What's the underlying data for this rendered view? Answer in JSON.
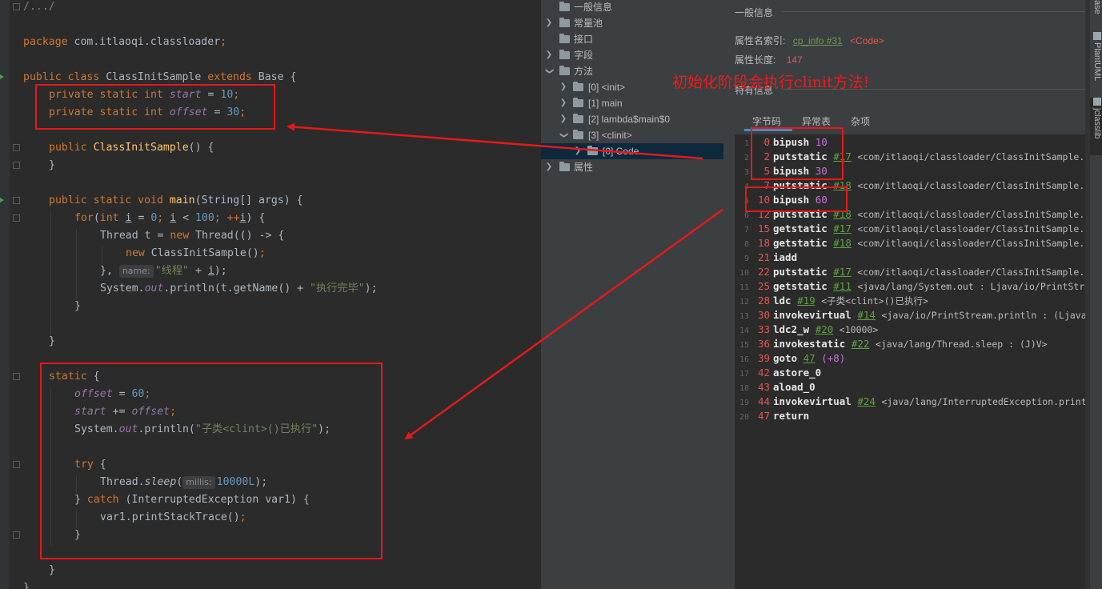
{
  "editor": {
    "lines": {
      "l1": {
        "comment": "/.../"
      },
      "l2": {
        "pkg": "package",
        "name": " com.itlaoqi.classloader",
        "semi": ";"
      },
      "l3": {
        "kw": "public class ",
        "cls": "ClassInitSample ",
        "ext": "extends ",
        "base": "Base {"
      },
      "l4": {
        "kw": "private static int ",
        "var": "start",
        "eq": " = ",
        "val": "10",
        "semi": ";"
      },
      "l5": {
        "kw": "private static int ",
        "var": "offset",
        "eq": " = ",
        "val": "30",
        "semi": ";"
      },
      "l6": {
        "kw": "public ",
        "mth": "ClassInitSample",
        "rest": "() {"
      },
      "l7": {
        "text": "}"
      },
      "l8": {
        "kw": "public static void ",
        "mth": "main",
        "rest": "(String[] args) {"
      },
      "l9": {
        "kw": "for",
        "a": "(",
        "kw2": "int ",
        "i1": "i",
        "b": " = ",
        "n0": "0",
        "c": "; ",
        "i2": "i",
        "d": " < ",
        "n100": "100",
        "e": "; ++",
        "i3": "i",
        "f": ") {"
      },
      "l10": {
        "a": "Thread t = ",
        "kw": "new ",
        "b": "Thread(() -> {"
      },
      "l11": {
        "kw": "new ",
        "b": "ClassInitSample()",
        "semi": ";"
      },
      "l12": {
        "a": "}, ",
        "hint": "name:",
        "str": "\"线程\"",
        "b": " + ",
        "i": "i",
        "c": ");"
      },
      "l13": {
        "a": "System.",
        "out": "out",
        "b": ".println(t.getName() + ",
        "str": "\"执行完毕\"",
        "c": ");"
      },
      "l14": {
        "text": "}"
      },
      "l15": {
        "text": "}"
      },
      "l16": {
        "kw": "static ",
        "b": "{"
      },
      "l17": {
        "var": "offset",
        "eq": " = ",
        "val": "60",
        "semi": ";"
      },
      "l18": {
        "var": "start",
        "op": " += ",
        "var2": "offset",
        "semi": ";"
      },
      "l19": {
        "a": "System.",
        "out": "out",
        "b": ".println(",
        "str": "\"子类<clint>()已执行\"",
        "c": ");"
      },
      "l20": {
        "kw": "try ",
        "b": "{"
      },
      "l21": {
        "a": "Thread.",
        "m": "sleep",
        "b": "(",
        "hint": "millis:",
        "val": "10000L",
        "c": ");"
      },
      "l22": {
        "a": "} ",
        "kw": "catch ",
        "b": "(InterruptedException var1) {"
      },
      "l23": {
        "a": "var1.printStackTrace()",
        "semi": ";"
      },
      "l24": {
        "text": "}"
      },
      "l25": {
        "text": "}"
      },
      "l26": {
        "text": "}"
      }
    }
  },
  "tree": {
    "items": [
      {
        "label": "一般信息"
      },
      {
        "label": "常量池"
      },
      {
        "label": "接口"
      },
      {
        "label": "字段"
      },
      {
        "label": "方法"
      },
      {
        "label": "[0] <init>"
      },
      {
        "label": "[1] main"
      },
      {
        "label": "[2] lambda$main$0"
      },
      {
        "label": "[3] <clinit>"
      },
      {
        "label": "[0] Code"
      },
      {
        "label": "属性"
      }
    ]
  },
  "detail": {
    "section_general": "一般信息",
    "name_index_label": "属性名索引:",
    "name_index_link": "cp_info #31",
    "name_index_tag": "<Code>",
    "length_label": "属性长度:",
    "length_value": "147",
    "specific_label": "特有信息",
    "tabs": [
      "字节码",
      "异常表",
      "杂项"
    ],
    "bytecode": [
      {
        "ln": "1",
        "off": "0",
        "op": "bipush",
        "num": "10"
      },
      {
        "ln": "2",
        "off": "2",
        "op": "putstatic",
        "ref": "#17",
        "arg": "<com/itlaoqi/classloader/ClassInitSample.start : I>"
      },
      {
        "ln": "3",
        "off": "5",
        "op": "bipush",
        "num": "30"
      },
      {
        "ln": "4",
        "off": "7",
        "op": "putstatic",
        "ref": "#18",
        "arg": "<com/itlaoqi/classloader/ClassInitSample.offset : I>"
      },
      {
        "ln": "5",
        "off": "10",
        "op": "bipush",
        "num": "60"
      },
      {
        "ln": "6",
        "off": "12",
        "op": "putstatic",
        "ref": "#18",
        "arg": "<com/itlaoqi/classloader/ClassInitSample.offset : I>"
      },
      {
        "ln": "7",
        "off": "15",
        "op": "getstatic",
        "ref": "#17",
        "arg": "<com/itlaoqi/classloader/ClassInitSample.start : I>"
      },
      {
        "ln": "8",
        "off": "18",
        "op": "getstatic",
        "ref": "#18",
        "arg": "<com/itlaoqi/classloader/ClassInitSample.offset : I>"
      },
      {
        "ln": "9",
        "off": "21",
        "op": "iadd"
      },
      {
        "ln": "10",
        "off": "22",
        "op": "putstatic",
        "ref": "#17",
        "arg": "<com/itlaoqi/classloader/ClassInitSample.start : I>"
      },
      {
        "ln": "11",
        "off": "25",
        "op": "getstatic",
        "ref": "#11",
        "arg": "<java/lang/System.out : Ljava/io/PrintStream;>"
      },
      {
        "ln": "12",
        "off": "28",
        "op": "ldc",
        "ref": "#19",
        "arg": "<子类<clint>()已执行>"
      },
      {
        "ln": "13",
        "off": "30",
        "op": "invokevirtual",
        "ref": "#14",
        "arg": "<java/io/PrintStream.println : (Ljava/lang/String;)V>"
      },
      {
        "ln": "14",
        "off": "33",
        "op": "ldc2_w",
        "ref": "#20",
        "arg": "<10000>"
      },
      {
        "ln": "15",
        "off": "36",
        "op": "invokestatic",
        "ref": "#22",
        "arg": "<java/lang/Thread.sleep : (J)V>"
      },
      {
        "ln": "16",
        "off": "39",
        "op": "goto",
        "ref": "47",
        "cm": "(+8)"
      },
      {
        "ln": "17",
        "off": "42",
        "op": "astore_0"
      },
      {
        "ln": "18",
        "off": "43",
        "op": "aload_0"
      },
      {
        "ln": "19",
        "off": "44",
        "op": "invokevirtual",
        "ref": "#24",
        "arg": "<java/lang/InterruptedException.printStackTrace : ()V>"
      },
      {
        "ln": "20",
        "off": "47",
        "op": "return"
      }
    ]
  },
  "annotation": {
    "note": "初始化阶段会执行clinit方法!"
  },
  "side": {
    "tab_top": "ase",
    "tab_plantuml": "PlantUML",
    "tab_jclasslib": "jclasslib"
  },
  "colors": {
    "annotation_red": "#e51919",
    "keyword": "#cc7832",
    "number": "#6897bb",
    "string": "#6a8759",
    "field": "#9876aa"
  }
}
